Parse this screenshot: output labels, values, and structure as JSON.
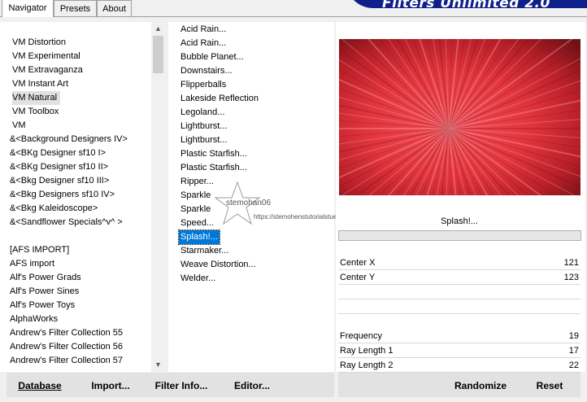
{
  "tabs": [
    {
      "label": "Navigator"
    },
    {
      "label": "Presets"
    },
    {
      "label": "About"
    }
  ],
  "banner": {
    "title": "Filters Unlimited 2.0"
  },
  "categories": [
    "VM Distortion",
    "VM Experimental",
    "VM Extravaganza",
    "VM Instant Art",
    "VM Natural",
    "VM Toolbox",
    "VM",
    "&<Background Designers IV>",
    "&<BKg Designer sf10 I>",
    "&<BKg Designer sf10 II>",
    "&<Bkg Designer sf10 III>",
    "&<Bkg Designers sf10 IV>",
    "&<Bkg Kaleidoscope>",
    "&<Sandflower Specials^v^ >",
    "",
    "[AFS IMPORT]",
    "AFS import",
    "Alf's Power Grads",
    "Alf's Power Sines",
    "Alf's Power Toys",
    "AlphaWorks",
    "Andrew's Filter Collection 55",
    "Andrew's Filter Collection 56",
    "Andrew's Filter Collection 57"
  ],
  "selected_category": "VM Natural",
  "filters": [
    "Acid Rain...",
    "Acid Rain...",
    "Bubble Planet...",
    "Downstairs...",
    "Flipperballs",
    "Lakeside Reflection",
    "Legoland...",
    "Lightburst...",
    "Lightburst...",
    "Plastic Starfish...",
    "Plastic Starfish...",
    "Ripper...",
    "Sparkle",
    "Sparkle",
    "Speed...",
    "Splash!...",
    "Starmaker...",
    "Weave Distortion...",
    "Welder..."
  ],
  "selected_filter": "Splash!...",
  "watermark": {
    "name": "stemohan06",
    "url": "https://stemohenstutorialstuecnen.de/"
  },
  "preview": {
    "filter_name": "Splash!...",
    "colors": {
      "center": "#f0484e",
      "mid": "#d93038",
      "dark": "#5a0d12"
    }
  },
  "parameters": [
    {
      "label": "Center X",
      "value": "121"
    },
    {
      "label": "Center Y",
      "value": "123"
    },
    {
      "label": "Frequency",
      "value": "19"
    },
    {
      "label": "Ray Length 1",
      "value": "17"
    },
    {
      "label": "Ray Length 2",
      "value": "22"
    }
  ],
  "buttons": {
    "database": "Database",
    "import": "Import...",
    "filter_info": "Filter Info...",
    "editor": "Editor...",
    "randomize": "Randomize",
    "reset": "Reset"
  }
}
